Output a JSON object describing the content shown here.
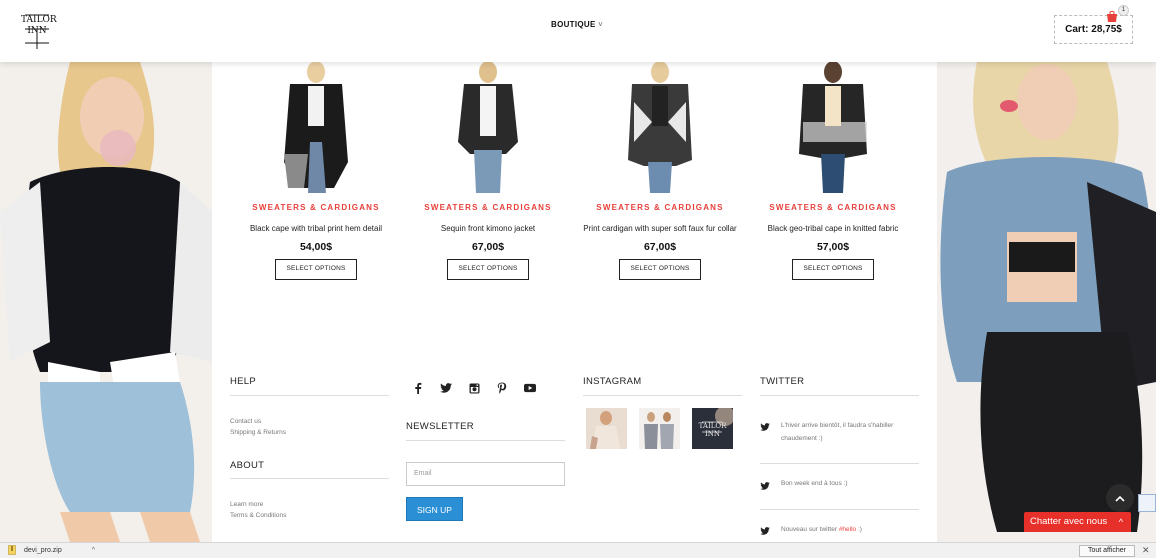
{
  "header": {
    "logo": "TAILOR INN",
    "nav_label": "BOUTIQUE",
    "cart_label": "Cart: 28,75$",
    "cart_count": "1"
  },
  "products": [
    {
      "category": "SWEATERS & CARDIGANS",
      "name": "Black cape with tribal print hem detail",
      "price": "54,00$",
      "button": "SELECT OPTIONS"
    },
    {
      "category": "SWEATERS & CARDIGANS",
      "name": "Sequin front kimono jacket",
      "price": "67,00$",
      "button": "SELECT OPTIONS"
    },
    {
      "category": "SWEATERS & CARDIGANS",
      "name": "Print cardigan with super soft faux fur collar",
      "price": "67,00$",
      "button": "SELECT OPTIONS"
    },
    {
      "category": "SWEATERS & CARDIGANS",
      "name": "Black geo-tribal cape in knitted fabric",
      "price": "57,00$",
      "button": "SELECT OPTIONS"
    }
  ],
  "footer": {
    "help": {
      "title": "HELP",
      "links": [
        "Contact us",
        "Shipping & Returns"
      ]
    },
    "about": {
      "title": "ABOUT",
      "links": [
        "Learn more",
        "Terms & Conditions"
      ]
    },
    "social_icons": [
      "facebook-icon",
      "twitter-icon",
      "instagram-icon",
      "pinterest-icon",
      "youtube-icon"
    ],
    "newsletter": {
      "title": "NEWSLETTER",
      "placeholder": "Email",
      "button": "SIGN UP"
    },
    "instagram": {
      "title": "INSTAGRAM",
      "thumb_logo": "TAILOR INN"
    },
    "twitter": {
      "title": "TWITTER",
      "tweets": [
        {
          "text": "L'hiver arrive bientôt, il faudra s'habiller chaudement :)"
        },
        {
          "text": "Bon week end à tous :)"
        },
        {
          "text": "Nouveau sur twitter ",
          "hashtag": "#hello",
          "suffix": " :)"
        }
      ]
    }
  },
  "chat": {
    "label": "Chatter avec nous"
  },
  "download_bar": {
    "file": "devi_pro.zip",
    "show_all": "Tout afficher"
  },
  "colors": {
    "accent": "#e8403b",
    "button_blue": "#2b8fd6",
    "chat_red": "#e8302b"
  }
}
